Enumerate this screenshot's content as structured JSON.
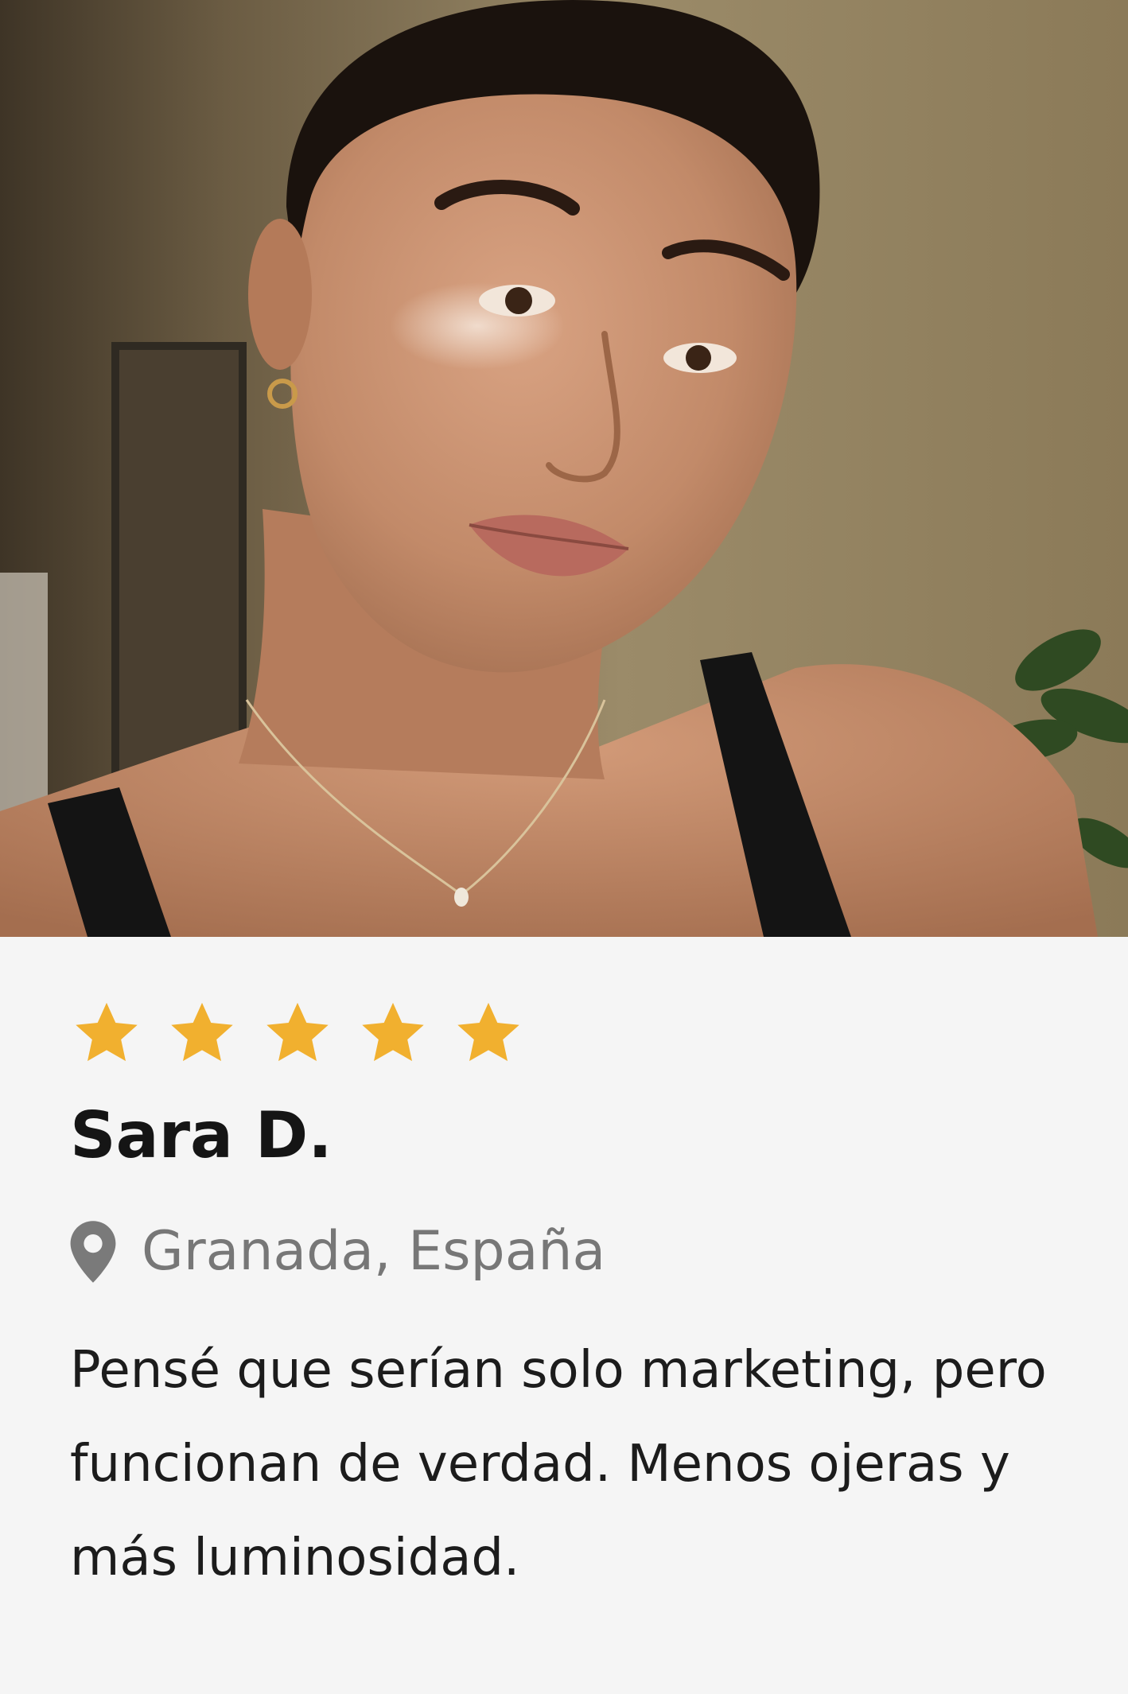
{
  "review_card": {
    "photo_alt": "customer-selfie",
    "rating": 5,
    "rating_max": 5,
    "star_color": "#f1b02f",
    "reviewer_name": "Sara D.",
    "location": "Granada, España",
    "review_text": "Pensé que serían solo marketing, pero funcionan de verdad. Menos ojeras y más luminosidad.",
    "icons": {
      "location": "map-pin-icon",
      "star": "star-icon"
    }
  }
}
